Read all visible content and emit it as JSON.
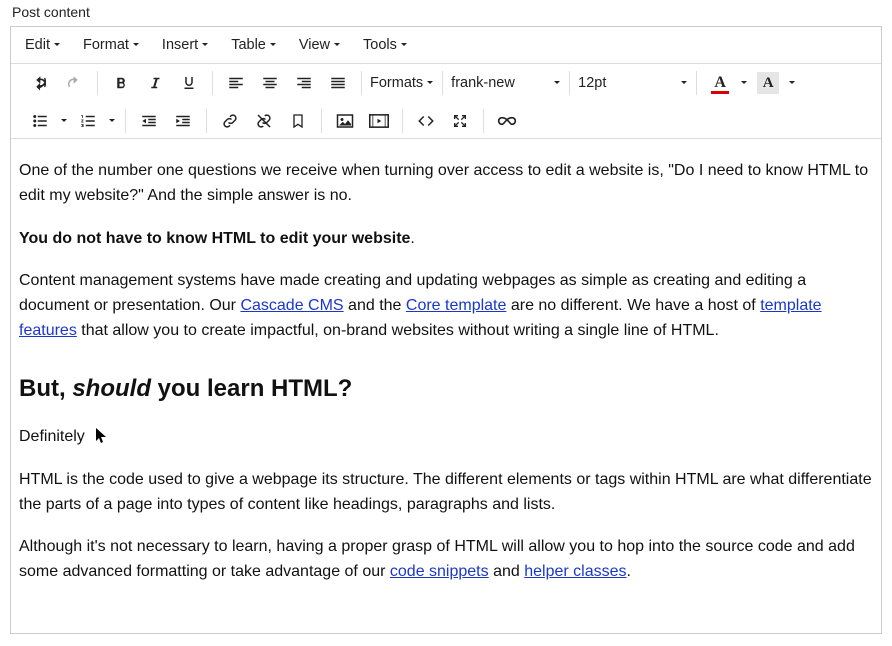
{
  "field": {
    "label": "Post content"
  },
  "menubar": {
    "edit": "Edit",
    "format": "Format",
    "insert": "Insert",
    "table": "Table",
    "view": "View",
    "tools": "Tools"
  },
  "toolbar": {
    "formats": "Formats",
    "font_family": "frank-new",
    "font_size": "12pt",
    "text_color": "#d90007",
    "highlight_color": "#e6e6e6",
    "a_glyph": "A"
  },
  "content": {
    "p1": "One of the number one questions we receive when turning over access to edit a website is, \"Do I need to know HTML to edit my website?\" And the simple answer is no.",
    "p2_bold": "You do not have to know HTML to edit your website",
    "p2_suffix": ".",
    "p3_a": "Content management systems have made creating and updating webpages as simple as creating and editing a document or presentation. Our ",
    "p3_link1": "Cascade CMS",
    "p3_b": " and the ",
    "p3_link2": "Core template",
    "p3_c": " are no different. We have a host of ",
    "p3_link3": "template features",
    "p3_d": " that allow you to create impactful, on-brand websites without writing a single line of HTML.",
    "h2_a": "But, ",
    "h2_em": "should",
    "h2_b": " you learn HTML?",
    "p4": "Definitely",
    "p5": "HTML is the code used to give a webpage its structure. The different elements or tags within HTML are what differentiate the parts of a page into types of content like headings, paragraphs and lists.",
    "p6_a": "Although it's not necessary to learn, having a proper grasp of HTML will allow you to hop into the source code and add some advanced formatting or take advantage of our ",
    "p6_link1": "code snippets",
    "p6_b": " and ",
    "p6_link2": "helper classes",
    "p6_c": "."
  }
}
